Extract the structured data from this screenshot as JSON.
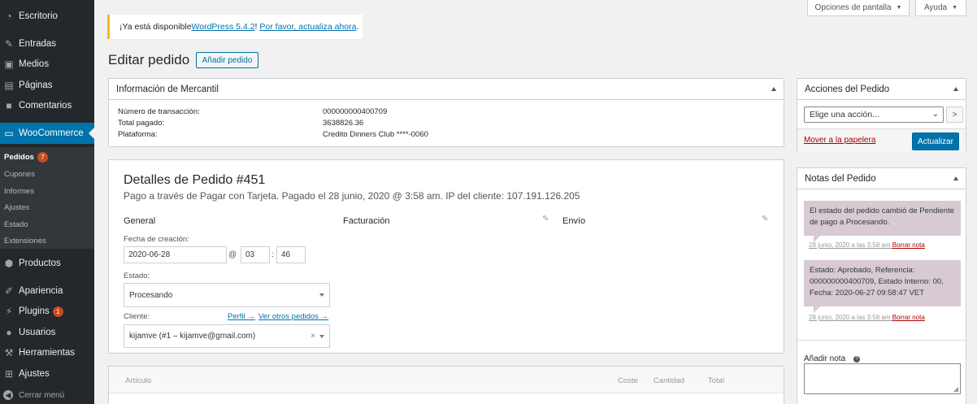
{
  "sidebar": {
    "items": [
      {
        "label": "Escritorio",
        "icon": "dashboard-icon"
      },
      {
        "label": "Entradas",
        "icon": "pin-icon"
      },
      {
        "label": "Medios",
        "icon": "media-icon"
      },
      {
        "label": "Páginas",
        "icon": "page-icon"
      },
      {
        "label": "Comentarios",
        "icon": "comment-icon"
      },
      {
        "label": "WooCommerce",
        "icon": "woocommerce-icon"
      },
      {
        "label": "Productos",
        "icon": "box-icon"
      },
      {
        "label": "Apariencia",
        "icon": "brush-icon"
      },
      {
        "label": "Plugins",
        "icon": "plugin-icon",
        "badge": "1"
      },
      {
        "label": "Usuarios",
        "icon": "user-icon"
      },
      {
        "label": "Herramientas",
        "icon": "wrench-icon"
      },
      {
        "label": "Ajustes",
        "icon": "settings-icon"
      }
    ],
    "submenu": [
      {
        "label": "Pedidos",
        "badge": "7"
      },
      {
        "label": "Cupones"
      },
      {
        "label": "Informes"
      },
      {
        "label": "Ajustes"
      },
      {
        "label": "Estado"
      },
      {
        "label": "Extensiones"
      }
    ],
    "collapse_label": "Cerrar menú"
  },
  "top_buttons": {
    "screen_options": "Opciones de pantalla",
    "help": "Ayuda"
  },
  "notice": {
    "prefix": "¡Ya está disponible ",
    "version_link": "WordPress 5.4.2",
    "middle": "! ",
    "update_link": "Por favor, actualiza ahora",
    "suffix": "."
  },
  "header": {
    "title": "Editar pedido",
    "add_button": "Añadir pedido"
  },
  "mercantil": {
    "title": "Información de Mercantil",
    "rows": [
      {
        "label": "Número de transacción:",
        "value": "000000000400709"
      },
      {
        "label": "Total pagado:",
        "value": "3638826.36"
      },
      {
        "label": "Plataforma:",
        "value": "Credito Dinners Club ****-0060"
      }
    ]
  },
  "order": {
    "title": "Detalles de Pedido #451",
    "subtitle": "Pago a través de Pagar con Tarjeta. Pagado el 28 junio, 2020 @ 3:58 am. IP del cliente: 107.191.126.205",
    "col_general": "General",
    "col_billing": "Facturación",
    "col_shipping": "Envío",
    "created_label": "Fecha de creación:",
    "date": "2020-06-28",
    "at": "@",
    "hour": "03",
    "colon": ":",
    "minute": "46",
    "status_label": "Estado:",
    "status": "Procesando",
    "client_label": "Cliente:",
    "profile_link": "Perfil →",
    "other_orders_link": "Ver otros pedidos →",
    "client": "kijamve (#1 – kijamve@gmail.com)",
    "clear": "×"
  },
  "items": {
    "article": "Artículo",
    "cost": "Coste",
    "quantity": "Cantidad",
    "total": "Total"
  },
  "actions": {
    "title": "Acciones del Pedido",
    "select_placeholder": "Elige una acción...",
    "go": ">",
    "trash": "Mover a la papelera",
    "update": "Actualizar"
  },
  "notes": {
    "title": "Notas del Pedido",
    "list": [
      {
        "text": "El estado del pedido cambió de Pendiente de pago a Procesando.",
        "meta": "28 junio, 2020 a las 3:58 am",
        "delete": "Borrar nota"
      },
      {
        "text": "Estado: Aprobado, Referencia: 000000000400709, Estado Interno: 00, Fecha: 2020-06-27 09:58:47 VET",
        "meta": "28 junio, 2020 a las 3:58 am",
        "delete": "Borrar nota"
      }
    ],
    "add_label": "Añadir nota",
    "help": "?"
  },
  "colors": {
    "sidebar_bg": "#23282d",
    "accent": "#0073aa",
    "badge": "#ca4a1f",
    "note_bg": "#d7cad2",
    "notice_border": "#ffb900"
  }
}
